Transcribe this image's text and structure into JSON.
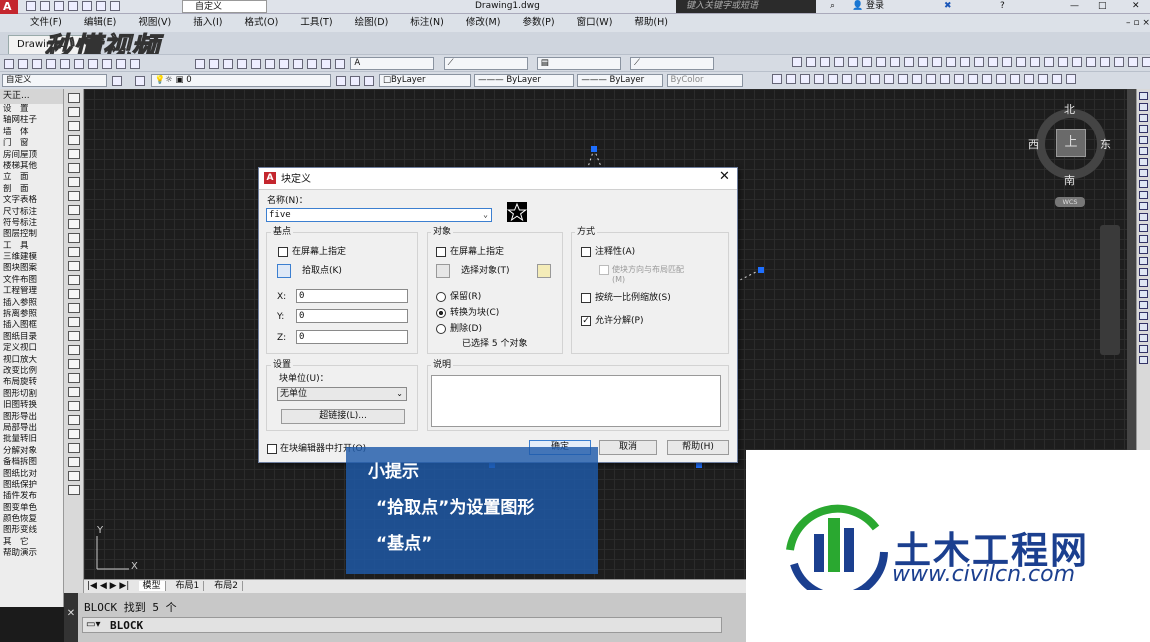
{
  "titlebar": {
    "filename": "Drawing1.dwg",
    "workspace": "自定义",
    "search_placeholder": "键入关键字或短语",
    "login": "登录"
  },
  "menu": [
    "文件(F)",
    "编辑(E)",
    "视图(V)",
    "插入(I)",
    "格式(O)",
    "工具(T)",
    "绘图(D)",
    "标注(N)",
    "修改(M)",
    "参数(P)",
    "窗口(W)",
    "帮助(H)"
  ],
  "drawing_tab": "Drawing1",
  "watermark_top": "秒懂视频",
  "toolbar2": {
    "workspace": "自定义",
    "layer": "0",
    "color": "ByLayer",
    "linetype": "ByLayer",
    "lineweight": "ByLayer",
    "plotstyle": "ByColor"
  },
  "left_panel": {
    "title": "天正...",
    "items": [
      "设　置",
      "轴网柱子",
      "墙　体",
      "门　窗",
      "房间屋顶",
      "楼梯其他",
      "立　面",
      "剖　面",
      "文字表格",
      "尺寸标注",
      "符号标注",
      "图层控制",
      "工　具",
      "三维建模",
      "图块图案",
      "文件布图",
      "工程管理",
      "插入参照",
      "拆离参照",
      "插入图框",
      "图纸目录",
      "定义视口",
      "视口放大",
      "改变比例",
      "布局旋转",
      "图形切割",
      "旧图转换",
      "图形导出",
      "局部导出",
      "批量转旧",
      "分解对象",
      "备档拆图",
      "图纸比对",
      "图纸保护",
      "插件发布",
      "图变单色",
      "颜色恢复",
      "图形变线",
      "其　它",
      "帮助演示"
    ]
  },
  "compass": {
    "north": "北",
    "south": "南",
    "east": "东",
    "west": "西",
    "center": "上",
    "wcs": "WCS"
  },
  "layout_tabs": [
    "模型",
    "布局1",
    "布局2"
  ],
  "command": {
    "line1": "BLOCK 找到 5 个",
    "line2": "BLOCK"
  },
  "dialog": {
    "title": "块定义",
    "name_label": "名称(N)：",
    "name_value": "five",
    "base_point": {
      "group": "基点",
      "specify_on_screen": "在屏幕上指定",
      "pick_point": "拾取点(K)",
      "x_label": "X:",
      "x": "0",
      "y_label": "Y:",
      "y": "0",
      "z_label": "Z:",
      "z": "0"
    },
    "objects": {
      "group": "对象",
      "specify_on_screen": "在屏幕上指定",
      "select_objects": "选择对象(T)",
      "retain": "保留(R)",
      "convert": "转换为块(C)",
      "delete": "删除(D)",
      "selected": "已选择 5 个对象"
    },
    "behavior": {
      "group": "方式",
      "annotative": "注释性(A)",
      "match_orientation": "使块方向与布局匹配(M)",
      "scale_uniformly": "按统一比例缩放(S)",
      "allow_explode": "允许分解(P)"
    },
    "settings": {
      "group": "设置",
      "unit_label": "块单位(U)：",
      "unit_value": "无单位",
      "hyperlink": "超链接(L)..."
    },
    "description_label": "说明",
    "open_in_editor": "在块编辑器中打开(O)",
    "ok": "确定",
    "cancel": "取消",
    "help": "帮助(H)"
  },
  "tip": {
    "title": "小提示",
    "line1": "“拾取点”为设置图形",
    "line2": "“基点”"
  },
  "logo": {
    "name": "土木工程网",
    "url": "www.civilcn.com"
  },
  "colors": {
    "canvas": "#1d1d1d",
    "tip_blue": "#1e5aaa",
    "logo_blue": "#1b3f8f",
    "logo_green": "#2aa830",
    "grip_blue": "#1e6fff"
  }
}
